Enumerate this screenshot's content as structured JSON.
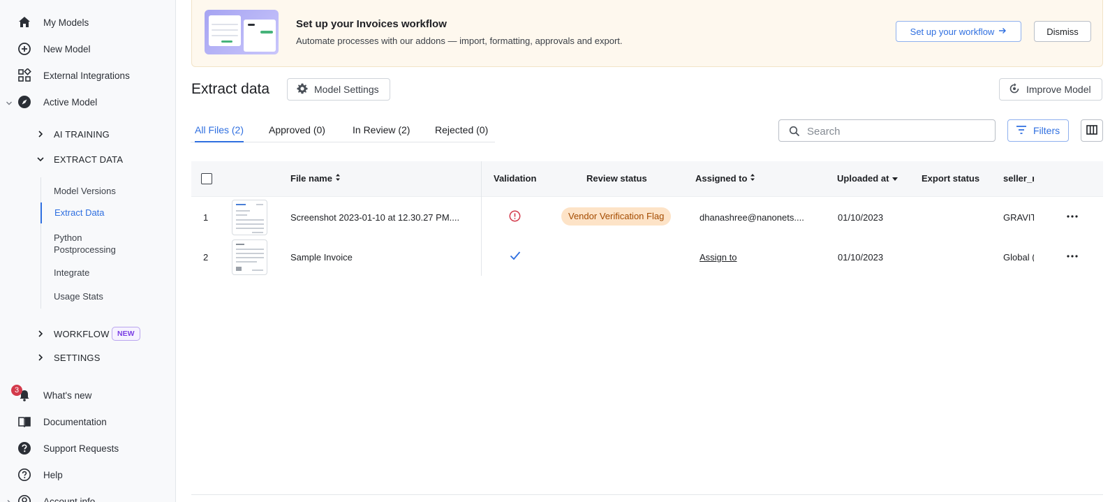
{
  "sidebar": {
    "top_items": [
      {
        "label": "My Models",
        "icon": "home-icon"
      },
      {
        "label": "New Model",
        "icon": "plus-circle-icon"
      },
      {
        "label": "External Integrations",
        "icon": "integrations-icon"
      },
      {
        "label": "Active Model",
        "icon": "compass-icon"
      }
    ],
    "sections": [
      {
        "label": "AI TRAINING",
        "expanded": false
      },
      {
        "label": "EXTRACT DATA",
        "expanded": true
      },
      {
        "label": "WORKFLOW",
        "expanded": false,
        "badge": "NEW"
      },
      {
        "label": "SETTINGS",
        "expanded": false
      }
    ],
    "extract_sub_items": [
      {
        "label": "Model Versions"
      },
      {
        "label": "Extract Data",
        "active": true
      },
      {
        "label": "Python Postprocessing"
      },
      {
        "label": "Integrate"
      },
      {
        "label": "Usage Stats"
      }
    ],
    "bottom_items": [
      {
        "label": "What's new",
        "icon": "bell-icon",
        "badge": "3"
      },
      {
        "label": "Documentation",
        "icon": "book-icon"
      },
      {
        "label": "Support Requests",
        "icon": "help-filled-icon"
      },
      {
        "label": "Help",
        "icon": "question-circle-icon"
      },
      {
        "label": "Account info",
        "icon": "account-icon"
      }
    ]
  },
  "banner": {
    "title": "Set up your Invoices workflow",
    "subtitle": "Automate processes with our addons — import, formatting, approvals and export.",
    "setup_label": "Set up your workflow",
    "dismiss_label": "Dismiss"
  },
  "header": {
    "title": "Extract data",
    "settings_label": "Model Settings",
    "improve_label": "Improve Model"
  },
  "tabs": [
    {
      "label": "All Files (2)",
      "active": true
    },
    {
      "label": "Approved (0)"
    },
    {
      "label": "In Review (2)"
    },
    {
      "label": "Rejected (0)"
    }
  ],
  "search": {
    "placeholder": "Search",
    "value": ""
  },
  "filters_label": "Filters",
  "table": {
    "columns": [
      "File name",
      "Validation",
      "Review status",
      "Assigned to",
      "Uploaded at",
      "Export status",
      "seller_r"
    ],
    "rows": [
      {
        "index": "1",
        "file_name": "Screenshot 2023-01-10 at 12.30.27 PM....",
        "validation": "error",
        "review_status": "Vendor Verification Flag",
        "assigned_to": "dhanashree@nanonets....",
        "uploaded_at": "01/10/2023",
        "export_status": "",
        "seller": "GRAVIT"
      },
      {
        "index": "2",
        "file_name": "Sample Invoice",
        "validation": "ok",
        "review_status": "",
        "assigned_to": "Assign to",
        "uploaded_at": "01/10/2023",
        "export_status": "",
        "seller": "Global ("
      }
    ]
  },
  "colors": {
    "accent": "#2f6fe0",
    "error": "#d33a4b",
    "flag_bg": "#fde3c7",
    "flag_text": "#a44b00",
    "banner_bg": "#fef8ee"
  }
}
